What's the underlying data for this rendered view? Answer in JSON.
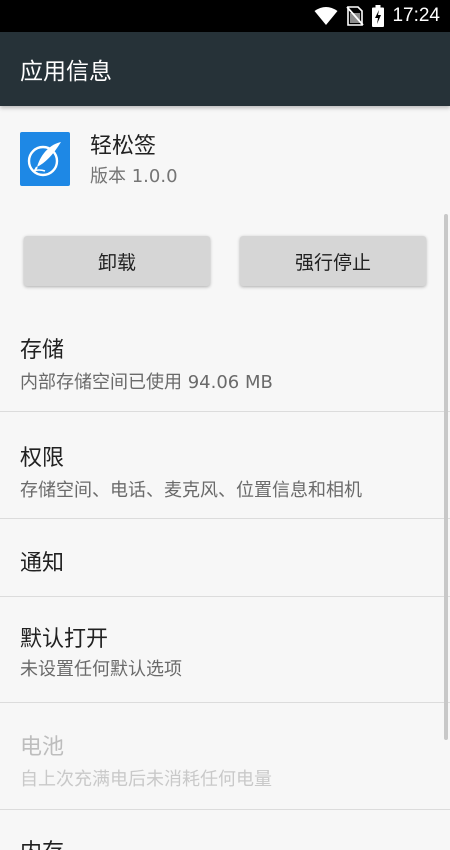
{
  "status_bar": {
    "time": "17:24",
    "icons": [
      "wifi-icon",
      "no-sim-icon",
      "battery-charging-icon"
    ]
  },
  "app_bar": {
    "title": "应用信息"
  },
  "app": {
    "name": "轻松签",
    "version": "版本 1.0.0",
    "icon": "feather-pen-icon",
    "icon_color": "#1e88e5"
  },
  "buttons": {
    "uninstall": "卸载",
    "force_stop": "强行停止"
  },
  "items": [
    {
      "title": "存储",
      "subtitle": "内部存储空间已使用 94.06 MB",
      "enabled": true
    },
    {
      "title": "权限",
      "subtitle": "存储空间、电话、麦克风、位置信息和相机",
      "enabled": true
    },
    {
      "title": "通知",
      "subtitle": "",
      "enabled": true
    },
    {
      "title": "默认打开",
      "subtitle": "未设置任何默认选项",
      "enabled": true
    },
    {
      "title": "电池",
      "subtitle": "自上次充满电后未消耗任何电量",
      "enabled": false
    },
    {
      "title": "内存",
      "subtitle": "",
      "enabled": true
    }
  ],
  "colors": {
    "app_bar": "#263238",
    "status_bar": "#000000",
    "background": "#f7f7f7",
    "button": "#d6d6d6"
  }
}
